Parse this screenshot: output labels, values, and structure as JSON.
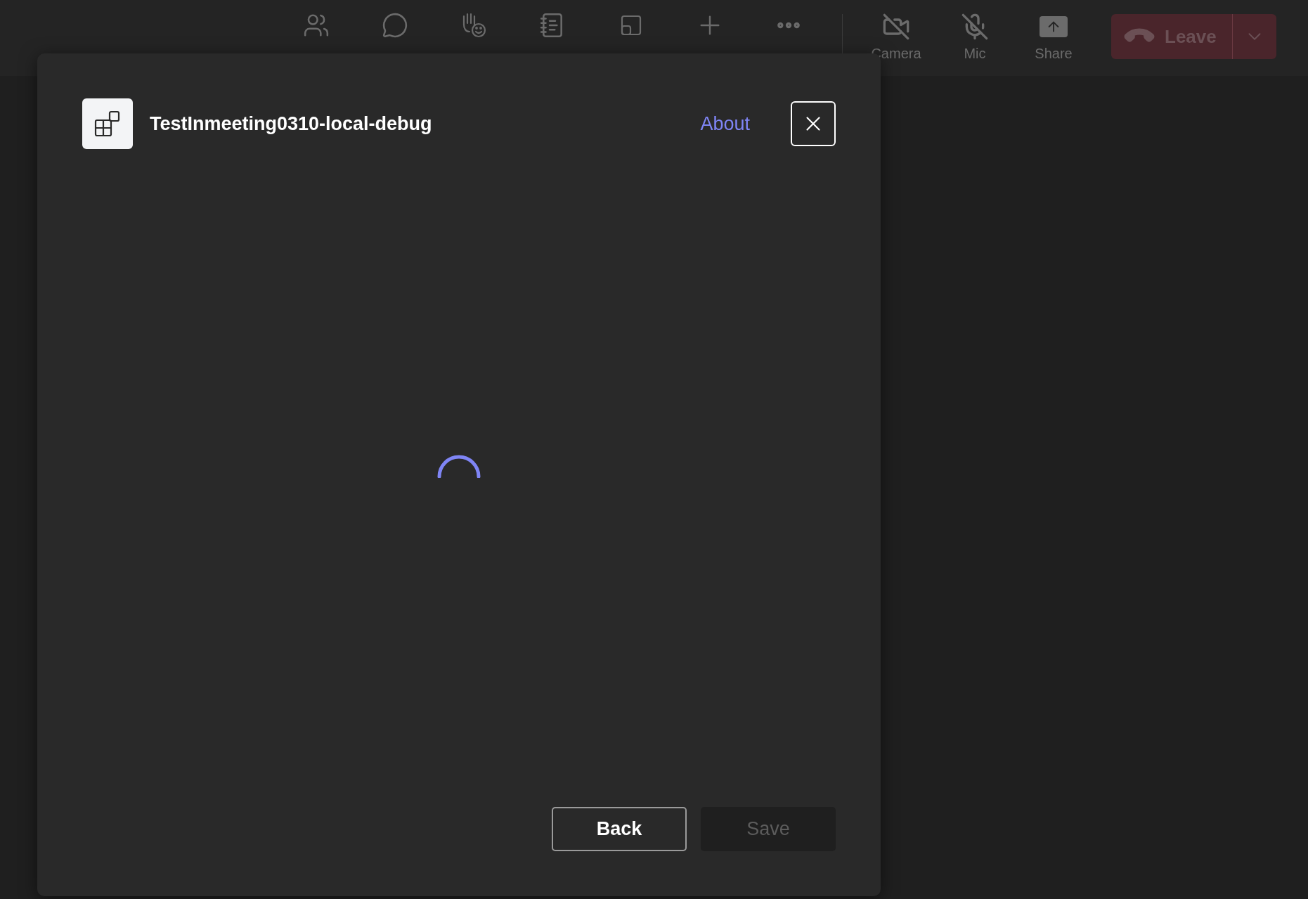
{
  "toolbar": {
    "controls": [
      {
        "label": "Camera",
        "off": true
      },
      {
        "label": "Mic",
        "off": true
      },
      {
        "label": "Share",
        "off": false
      }
    ],
    "leave": {
      "label": "Leave"
    }
  },
  "dialog": {
    "title": "TestInmeeting0310-local-debug",
    "about": "About",
    "loading": true,
    "buttons": [
      {
        "label": "Back",
        "disabled": false
      },
      {
        "label": "Save",
        "disabled": true
      }
    ]
  }
}
